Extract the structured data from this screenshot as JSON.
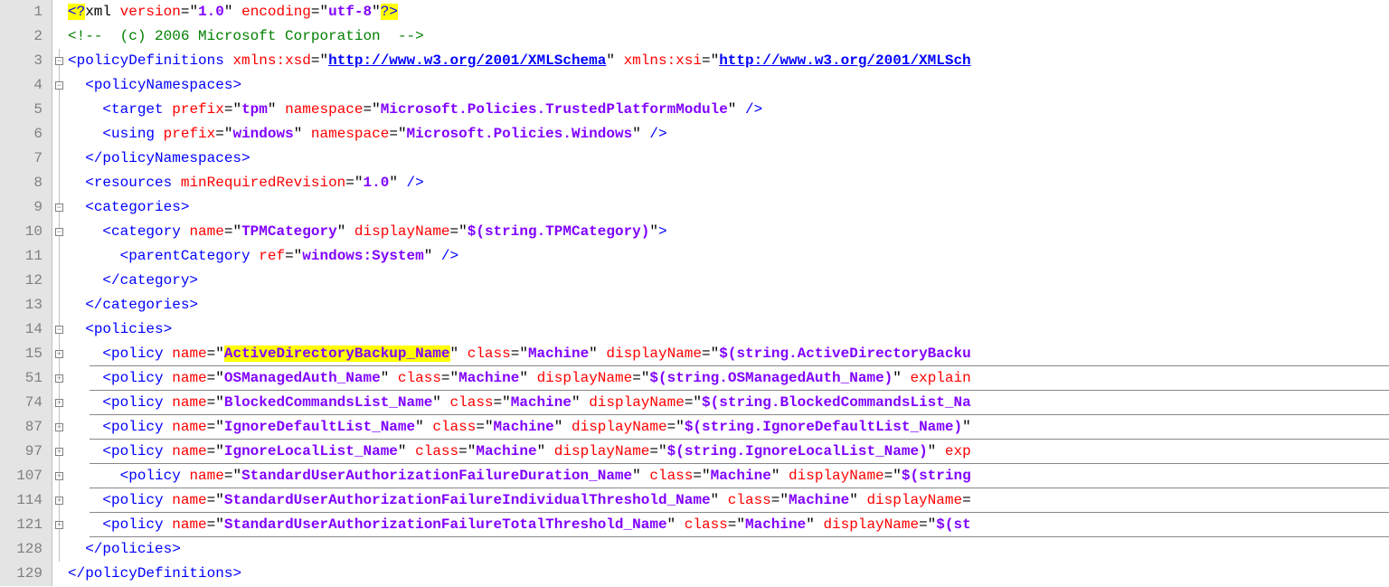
{
  "lineNumbers": [
    "1",
    "2",
    "3",
    "4",
    "5",
    "6",
    "7",
    "8",
    "9",
    "10",
    "11",
    "12",
    "13",
    "14",
    "15",
    "51",
    "74",
    "87",
    "97",
    "107",
    "114",
    "121",
    "128",
    "129"
  ],
  "fold": {
    "l1": "",
    "l2": "",
    "l3": "minus",
    "l4": "minus",
    "l5": "bar",
    "l6": "bar",
    "l7": "bar",
    "l8": "bar",
    "l9": "minus",
    "l10": "minus",
    "l11": "bar",
    "l12": "bar",
    "l13": "bar",
    "l14": "minus",
    "l15": "plus",
    "l16": "plus",
    "l17": "plus",
    "l18": "plus",
    "l19": "plus",
    "l20": "plus",
    "l21": "plus",
    "l22": "plus",
    "l23": "bar",
    "l24": ""
  },
  "code": {
    "line1": {
      "xmlOpen": "<?",
      "xml": "xml",
      "versionAttr": "version",
      "eq": "=",
      "q": "\"",
      "versionVal": "1.0",
      "encodingAttr": "encoding",
      "encodingVal": "utf-8",
      "xmlClose": "?>"
    },
    "line2": {
      "comment": "<!--  (c) 2006 Microsoft Corporation  -->"
    },
    "line3": {
      "open": "<",
      "tag": "policyDefinitions",
      "a1": "xmlns:xsd",
      "eq": "=",
      "q": "\"",
      "v1": "http://www.w3.org/2001/XMLSchema",
      "a2": "xmlns:xsi",
      "v2": "http://www.w3.org/2001/XMLSch"
    },
    "line4": {
      "indent": "  ",
      "open": "<",
      "tag": "policyNamespaces",
      "close": ">"
    },
    "line5": {
      "indent": "    ",
      "open": "<",
      "tag": "target",
      "a1": "prefix",
      "v1": "tpm",
      "a2": "namespace",
      "v2": "Microsoft.Policies.TrustedPlatformModule",
      "selfclose": " />"
    },
    "line6": {
      "indent": "    ",
      "open": "<",
      "tag": "using",
      "a1": "prefix",
      "v1": "windows",
      "a2": "namespace",
      "v2": "Microsoft.Policies.Windows",
      "selfclose": " />"
    },
    "line7": {
      "indent": "  ",
      "open": "</",
      "tag": "policyNamespaces",
      "close": ">"
    },
    "line8": {
      "indent": "  ",
      "open": "<",
      "tag": "resources",
      "a1": "minRequiredRevision",
      "v1": "1.0",
      "selfclose": " />"
    },
    "line9": {
      "indent": "  ",
      "open": "<",
      "tag": "categories",
      "close": ">"
    },
    "line10": {
      "indent": "    ",
      "open": "<",
      "tag": "category",
      "a1": "name",
      "v1": "TPMCategory",
      "a2": "displayName",
      "v2": "$(string.TPMCategory)",
      "close": ">"
    },
    "line11": {
      "indent": "      ",
      "open": "<",
      "tag": "parentCategory",
      "a1": "ref",
      "v1": "windows:System",
      "selfclose": " />"
    },
    "line12": {
      "indent": "    ",
      "open": "</",
      "tag": "category",
      "close": ">"
    },
    "line13": {
      "indent": "  ",
      "open": "</",
      "tag": "categories",
      "close": ">"
    },
    "line14": {
      "indent": "  ",
      "open": "<",
      "tag": "policies",
      "close": ">"
    },
    "line15": {
      "indent": "    ",
      "open": "<",
      "tag": "policy",
      "a1": "name",
      "v1": "ActiveDirectoryBackup_Name",
      "a2": "class",
      "v2": "Machine",
      "a3": "displayName",
      "v3": "$(string.ActiveDirectoryBacku"
    },
    "line16": {
      "indent": "    ",
      "open": "<",
      "tag": "policy",
      "a1": "name",
      "v1": "OSManagedAuth_Name",
      "a2": "class",
      "v2": "Machine",
      "a3": "displayName",
      "v3": "$(string.OSManagedAuth_Name)",
      "a4": "explain"
    },
    "line17": {
      "indent": "    ",
      "open": "<",
      "tag": "policy",
      "a1": "name",
      "v1": "BlockedCommandsList_Name",
      "a2": "class",
      "v2": "Machine",
      "a3": "displayName",
      "v3": "$(string.BlockedCommandsList_Na"
    },
    "line18": {
      "indent": "    ",
      "open": "<",
      "tag": "policy",
      "a1": "name",
      "v1": "IgnoreDefaultList_Name",
      "a2": "class",
      "v2": "Machine",
      "a3": "displayName",
      "v3": "$(string.IgnoreDefaultList_Name)",
      "tail": "\""
    },
    "line19": {
      "indent": "    ",
      "open": "<",
      "tag": "policy",
      "a1": "name",
      "v1": "IgnoreLocalList_Name",
      "a2": "class",
      "v2": "Machine",
      "a3": "displayName",
      "v3": "$(string.IgnoreLocalList_Name)",
      "a4": "exp"
    },
    "line20": {
      "indent": "      ",
      "open": "<",
      "tag": "policy",
      "a1": "name",
      "v1": "StandardUserAuthorizationFailureDuration_Name",
      "a2": "class",
      "v2": "Machine",
      "a3": "displayName",
      "v3": "$(string"
    },
    "line21": {
      "indent": "    ",
      "open": "<",
      "tag": "policy",
      "a1": "name",
      "v1": "StandardUserAuthorizationFailureIndividualThreshold_Name",
      "a2": "class",
      "v2": "Machine",
      "a3": "displayName",
      "eq": "="
    },
    "line22": {
      "indent": "    ",
      "open": "<",
      "tag": "policy",
      "a1": "name",
      "v1": "StandardUserAuthorizationFailureTotalThreshold_Name",
      "a2": "class",
      "v2": "Machine",
      "a3": "displayName",
      "v3": "$(st"
    },
    "line23": {
      "indent": "  ",
      "open": "</",
      "tag": "policies",
      "close": ">"
    },
    "line24": {
      "open": "</",
      "tag": "policyDefinitions",
      "close": ">"
    }
  }
}
